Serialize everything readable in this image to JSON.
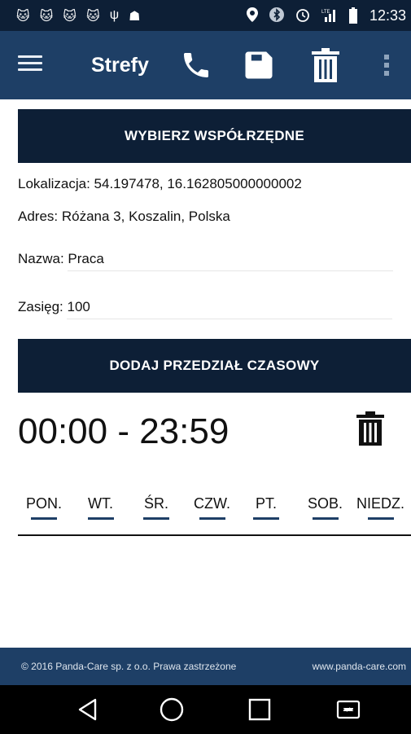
{
  "status_bar": {
    "notification_icons": [
      "cat-icon",
      "cat-icon",
      "cat-icon",
      "cat-icon",
      "usb-icon",
      "android-icon"
    ],
    "system_icons": [
      "location-pin-icon",
      "bluetooth-icon",
      "alarm-icon",
      "lte-signal-icon",
      "battery-icon"
    ],
    "clock": "12:33"
  },
  "app_bar": {
    "title": "Strefy",
    "actions": [
      "phone-icon",
      "save-icon",
      "trash-icon",
      "overflow-menu-icon"
    ]
  },
  "form": {
    "choose_coords_label": "WYBIERZ WSPÓŁRZĘDNE",
    "location_text": "Lokalizacja: 54.197478, 16.162805000000002",
    "address_text": "Adres: Różana 3, Koszalin, Polska",
    "name_label": "Nazwa:",
    "name_value": "Praca",
    "range_label": "Zasięg:",
    "range_value": "100",
    "add_time_range_label": "DODAJ PRZEDZIAŁ CZASOWY"
  },
  "time_slot": {
    "range": "00:00 - 23:59",
    "days": [
      "PON.",
      "WT.",
      "ŚR.",
      "CZW.",
      "PT.",
      "SOB.",
      "NIEDZ."
    ]
  },
  "footer": {
    "copyright": "© 2016 Panda-Care sp. z o.o. Prawa zastrzeżone",
    "website": "www.panda-care.com"
  },
  "colors": {
    "app_bar": "#1e3f66",
    "button_dark": "#0d1f36",
    "accent_underline": "#1e3f66"
  }
}
